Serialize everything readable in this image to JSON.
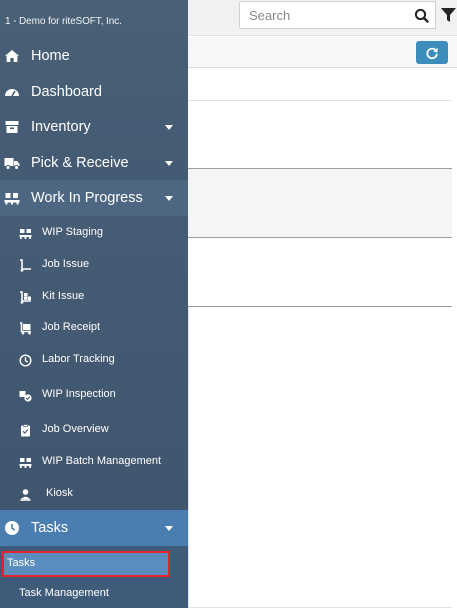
{
  "brand": "1 - Demo for riteSOFT, Inc.",
  "search": {
    "placeholder": "Search"
  },
  "icons": {
    "search": "search-icon",
    "filter": "filter-icon",
    "refresh": "refresh-icon"
  },
  "colors": {
    "sidebar": "#445b74",
    "active_section": "#4a7eb0",
    "active_item": "#5a8cbd",
    "highlight_border": "#e8222c",
    "refresh_button": "#3c8dbc"
  },
  "nav": {
    "home": "Home",
    "dashboard": "Dashboard",
    "inventory": "Inventory",
    "pick_receive": "Pick & Receive",
    "wip": "Work In Progress",
    "tasks": "Tasks"
  },
  "wip_items": {
    "staging": "WIP Staging",
    "job_issue": "Job Issue",
    "kit_issue": "Kit Issue",
    "job_receipt": "Job Receipt",
    "labor_tracking": "Labor Tracking",
    "wip_inspection": "WIP Inspection",
    "job_overview": "Job Overview",
    "batch_mgmt": "WIP Batch Management",
    "kiosk": "Kiosk"
  },
  "task_items": {
    "tasks": "Tasks",
    "task_management": "Task Management"
  }
}
